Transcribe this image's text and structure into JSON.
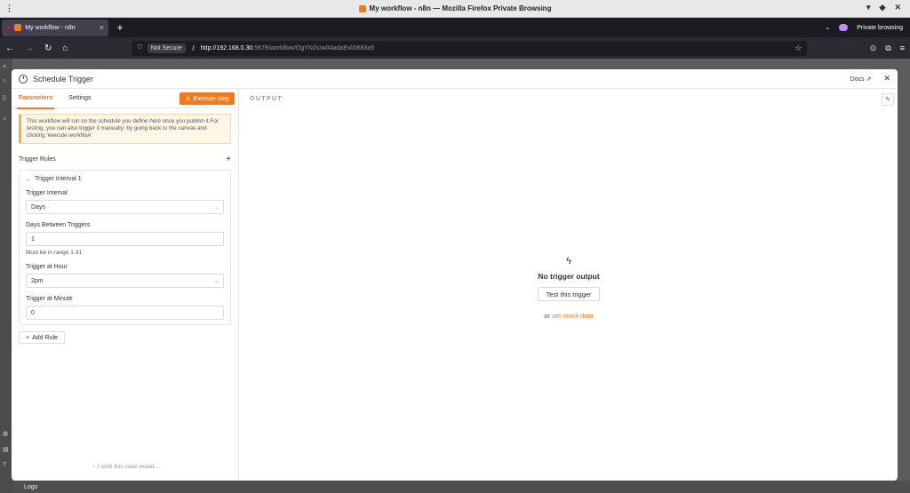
{
  "browser": {
    "window_title": "My workflow - n8n — Mozilla Firefox Private Browsing",
    "tab_title": "My workflow - n8n",
    "private_label": "Private browsing",
    "not_secure": "Not Secure",
    "url_host": "http://192.168.0.30",
    "url_rest": ":5678/workflow/OgYN2srw04adaExl/0683a5"
  },
  "modal": {
    "title": "Schedule Trigger",
    "docs": "Docs",
    "tabs": [
      "Parameters",
      "Settings"
    ],
    "execute_step": "Execute step",
    "notice": "This workflow will run on the schedule you define here once you publish it.For testing, you can also trigger it manually: by going back to the canvas and clicking 'execute workflow'",
    "trigger_rules_label": "Trigger Rules",
    "rule": {
      "title": "Trigger Interval 1",
      "interval_label": "Trigger Interval",
      "interval_value": "Days",
      "days_label": "Days Between Triggers",
      "days_value": "1",
      "days_hint": "Must be in range 1-31",
      "hour_label": "Trigger at Hour",
      "hour_value": "2pm",
      "minute_label": "Trigger at Minute",
      "minute_value": "0"
    },
    "add_rule": "Add Rule",
    "wish": "I wish this node would...",
    "output": {
      "label": "OUTPUT",
      "empty_title": "No trigger output",
      "test_button": "Test this trigger",
      "or_text": "or",
      "mock_link": "set mock data"
    }
  },
  "app": {
    "logs_label": "Logs"
  },
  "colors": {
    "accent": "#f07b1e"
  }
}
